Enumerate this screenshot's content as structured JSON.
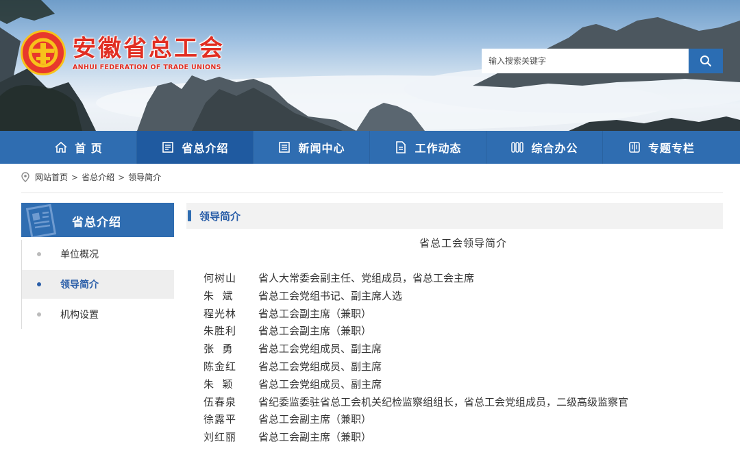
{
  "site": {
    "logo_cn": "安徽省总工会",
    "logo_en": "ANHUI FEDERATION OF TRADE UNIONS",
    "search_placeholder": "输入搜索关键字"
  },
  "nav": [
    {
      "label": "首 页",
      "icon": "home-icon"
    },
    {
      "label": "省总介绍",
      "icon": "document-icon"
    },
    {
      "label": "新闻中心",
      "icon": "news-icon"
    },
    {
      "label": "工作动态",
      "icon": "file-icon"
    },
    {
      "label": "综合办公",
      "icon": "office-icon"
    },
    {
      "label": "专题专栏",
      "icon": "book-icon"
    }
  ],
  "breadcrumb": [
    "网站首页",
    "省总介绍",
    "领导简介"
  ],
  "sidebar": {
    "title": "省总介绍",
    "items": [
      "单位概况",
      "领导简介",
      "机构设置"
    ],
    "active_index": 1
  },
  "content": {
    "section_title": "领导简介",
    "doc_title": "省总工会领导简介",
    "people": [
      {
        "name": "何树山",
        "title": "省人大常委会副主任、党组成员，省总工会主席"
      },
      {
        "name": "朱  斌",
        "title": "省总工会党组书记、副主席人选"
      },
      {
        "name": "程光林",
        "title": "省总工会副主席（兼职）"
      },
      {
        "name": "朱胜利",
        "title": "省总工会副主席（兼职）"
      },
      {
        "name": "张  勇",
        "title": "省总工会党组成员、副主席"
      },
      {
        "name": "陈金红",
        "title": "省总工会党组成员、副主席"
      },
      {
        "name": "朱  颖",
        "title": "省总工会党组成员、副主席"
      },
      {
        "name": "伍春泉",
        "title": "省纪委监委驻省总工会机关纪检监察组组长，省总工会党组成员，二级高级监察官"
      },
      {
        "name": "徐露平",
        "title": "省总工会副主席（兼职）"
      },
      {
        "name": "刘红丽",
        "title": "省总工会副主席（兼职）"
      }
    ]
  },
  "colors": {
    "nav_blue": "#2f6db1",
    "logo_red": "#e12e22",
    "accent_text": "#2a5ea8"
  }
}
